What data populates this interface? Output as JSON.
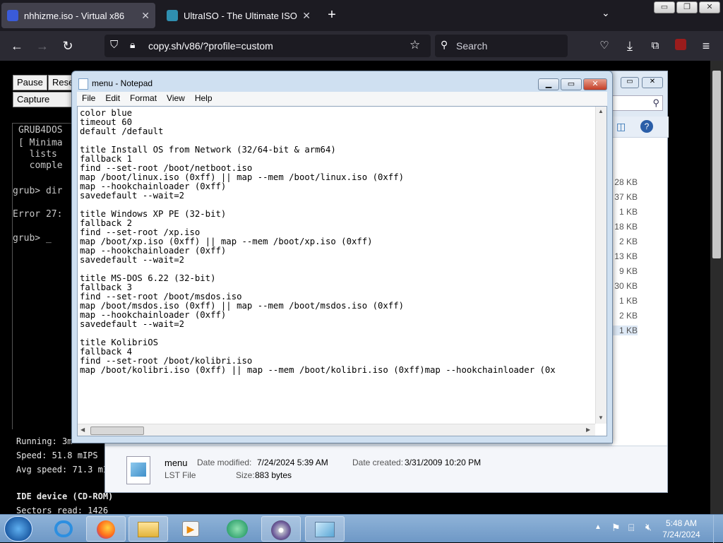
{
  "browser": {
    "tabs": [
      {
        "title": "nhhizme.iso - Virtual x86",
        "active": true
      },
      {
        "title": "UltraISO - The Ultimate ISO CD/DVD",
        "active": false
      }
    ],
    "url": "copy.sh/v86/?profile=custom",
    "search_placeholder": "Search"
  },
  "v86": {
    "buttons": [
      "Pause",
      "Rese",
      "Capture netw"
    ],
    "terminal": [
      "GRUB4DOS",
      "[ Minima",
      "  lists ",
      "  comple",
      "grub> dir",
      "Error 27:",
      "grub> _"
    ],
    "stats": {
      "running": "Running: 3m",
      "speed": "Speed: 51.8 mIPS",
      "avg": "Avg speed: 71.3 mI",
      "ide": "IDE device (CD-ROM)",
      "sectors": "Sectors read: 1426"
    }
  },
  "explorer": {
    "sizes": [
      "28 KB",
      "37 KB",
      "1 KB",
      "18 KB",
      "2 KB",
      "13 KB",
      "9 KB",
      "30 KB",
      "1 KB",
      "2 KB",
      "1 KB"
    ],
    "details": {
      "name": "menu",
      "type": "LST File",
      "modified_label": "Date modified:",
      "modified": "7/24/2024 5:39 AM",
      "created_label": "Date created:",
      "created": "3/31/2009 10:20 PM",
      "size_label": "Size:",
      "size": "883 bytes"
    }
  },
  "notepad": {
    "title": "menu - Notepad",
    "menu": [
      "File",
      "Edit",
      "Format",
      "View",
      "Help"
    ],
    "content": "color blue\ntimeout 60\ndefault /default\n\ntitle Install OS from Network (32/64-bit & arm64)\nfallback 1\nfind --set-root /boot/netboot.iso\nmap /boot/linux.iso (0xff) || map --mem /boot/linux.iso (0xff)\nmap --hookchainloader (0xff)\nsavedefault --wait=2\n\ntitle Windows XP PE (32-bit)\nfallback 2\nfind --set-root /xp.iso\nmap /boot/xp.iso (0xff) || map --mem /boot/xp.iso (0xff)\nmap --hookchainloader (0xff)\nsavedefault --wait=2\n\ntitle MS-DOS 6.22 (32-bit)\nfallback 3\nfind --set-root /boot/msdos.iso\nmap /boot/msdos.iso (0xff) || map --mem /boot/msdos.iso (0xff)\nmap --hookchainloader (0xff)\nsavedefault --wait=2\n\ntitle KolibriOS\nfallback 4\nfind --set-root /boot/kolibri.iso\nmap /boot/kolibri.iso (0xff) || map --mem /boot/kolibri.iso (0xff)map --hookchainloader (0x"
  },
  "taskbar": {
    "time": "5:48 AM",
    "date": "7/24/2024"
  },
  "colors": {
    "firefox_dark": "#1c1b22",
    "taskbar": "#7aa3cf",
    "notepad_frame": "#cfe0f1"
  }
}
